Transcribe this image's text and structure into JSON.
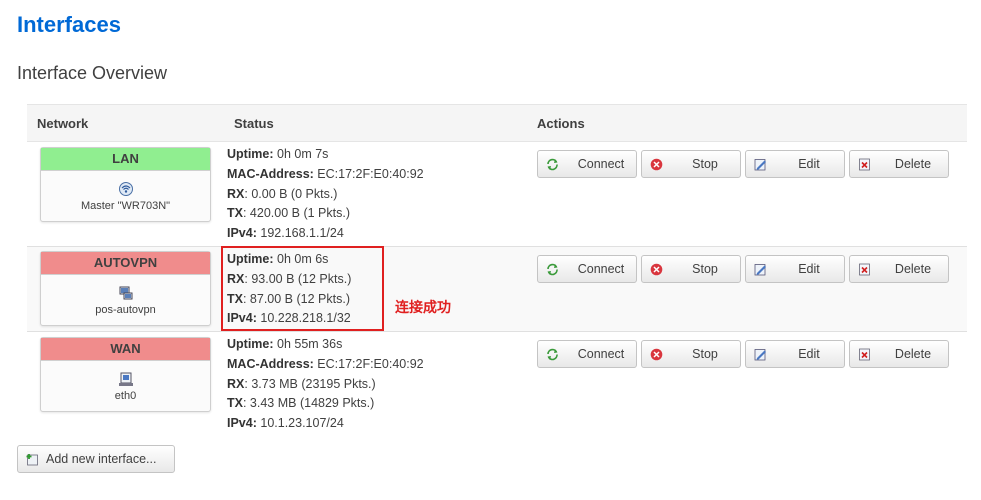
{
  "page_title": "Interfaces",
  "section_title": "Interface Overview",
  "table": {
    "headers": {
      "network": "Network",
      "status": "Status",
      "actions": "Actions"
    }
  },
  "rows": [
    {
      "name": "LAN",
      "header_color": "#90ee90",
      "icon": "wifi-icon",
      "device": "Master \"WR703N\"",
      "status": [
        {
          "label": "Uptime:",
          "value": " 0h 0m 7s"
        },
        {
          "label": "MAC-Address:",
          "value": " EC:17:2F:E0:40:92"
        },
        {
          "label": "RX",
          "value": ": 0.00 B (0 Pkts.)"
        },
        {
          "label": "TX",
          "value": ": 420.00 B (1 Pkts.)"
        },
        {
          "label": "IPv4:",
          "value": " 192.168.1.1/24"
        }
      ]
    },
    {
      "name": "AUTOVPN",
      "header_color": "#f08c8c",
      "icon": "vpn-tunnel-icon",
      "device": "pos-autovpn",
      "status": [
        {
          "label": "Uptime:",
          "value": " 0h 0m 6s"
        },
        {
          "label": "RX",
          "value": ": 93.00 B (12 Pkts.)"
        },
        {
          "label": "TX",
          "value": ": 87.00 B (12 Pkts.)"
        },
        {
          "label": "IPv4:",
          "value": " 10.228.218.1/32"
        }
      ]
    },
    {
      "name": "WAN",
      "header_color": "#f08c8c",
      "icon": "ethernet-icon",
      "device": "eth0",
      "status": [
        {
          "label": "Uptime:",
          "value": " 0h 55m 36s"
        },
        {
          "label": "MAC-Address:",
          "value": " EC:17:2F:E0:40:92"
        },
        {
          "label": "RX",
          "value": ": 3.73 MB (23195 Pkts.)"
        },
        {
          "label": "TX",
          "value": ": 3.43 MB (14829 Pkts.)"
        },
        {
          "label": "IPv4:",
          "value": " 10.1.23.107/24"
        }
      ]
    }
  ],
  "actions": {
    "connect": "Connect",
    "stop": "Stop",
    "edit": "Edit",
    "delete": "Delete"
  },
  "annotation": "连接成功",
  "annotation_color": "#e02020",
  "add_button": "Add new interface..."
}
